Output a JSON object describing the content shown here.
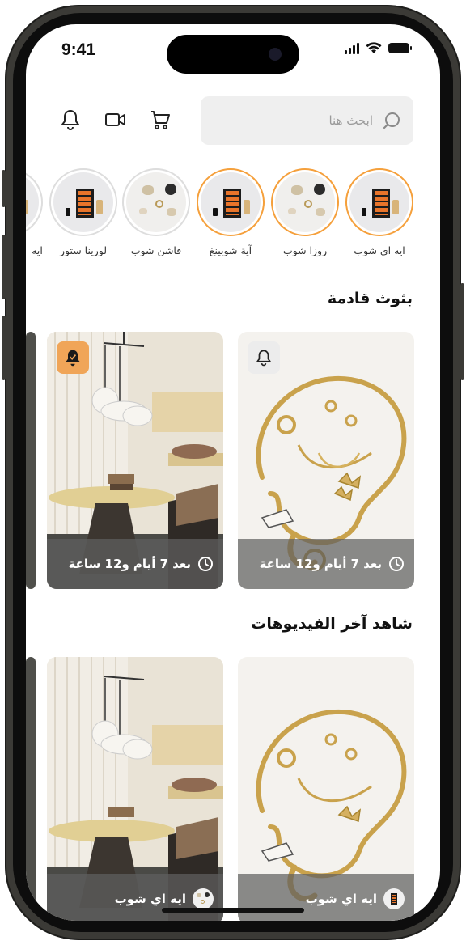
{
  "status": {
    "time": "9:41"
  },
  "search": {
    "placeholder": "ابحث هنا"
  },
  "header_icons": [
    "cart-icon",
    "video-icon",
    "bell-icon"
  ],
  "stories": [
    {
      "label": "ايه اي شوب",
      "active": true,
      "image": "product-set"
    },
    {
      "label": "روزا شوب",
      "active": true,
      "image": "jewelry-flatlay"
    },
    {
      "label": "آية شوبينغ",
      "active": true,
      "image": "product-set"
    },
    {
      "label": "فاشن شوب",
      "active": false,
      "image": "jewelry-flatlay"
    },
    {
      "label": "لورينا ستور",
      "active": false,
      "image": "product-set"
    },
    {
      "label": "ايه",
      "active": false,
      "image": "product-set"
    }
  ],
  "sections": {
    "upcoming_title": "بثوث قادمة",
    "videos_title": "شاهد آخر الفيديوهات"
  },
  "upcoming": [
    {
      "time_label": "بعد 7 أيام و12 ساعة",
      "bell": "outline",
      "image": "gold-jewelry"
    },
    {
      "time_label": "بعد 7 أيام و12 ساعة",
      "bell": "active",
      "image": "interior-room"
    }
  ],
  "videos": [
    {
      "shop": "ايه اي شوب",
      "image": "gold-jewelry"
    },
    {
      "shop": "ايه اي شوب",
      "image": "interior-room"
    }
  ],
  "colors": {
    "accent": "#f5a03c",
    "overlay": "#5f5f5f"
  }
}
